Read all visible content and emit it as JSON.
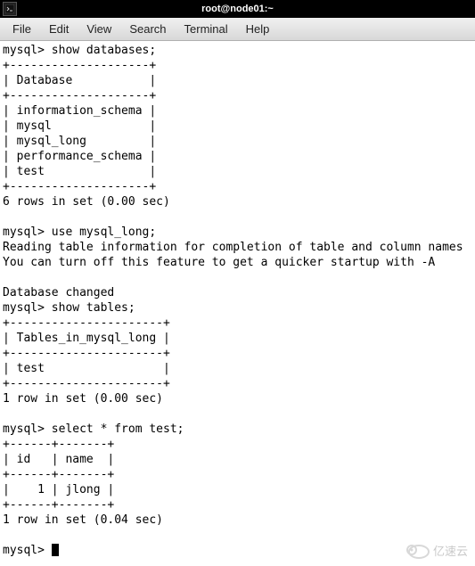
{
  "window": {
    "title": "root@node01:~"
  },
  "menu": {
    "items": [
      "File",
      "Edit",
      "View",
      "Search",
      "Terminal",
      "Help"
    ]
  },
  "terminal": {
    "prompt": "mysql>",
    "cmd_show_databases": "mysql> show databases;",
    "db_divider": "+--------------------+",
    "db_header": "| Database           |",
    "db_rows": [
      "| information_schema |",
      "| mysql              |",
      "| mysql_long         |",
      "| performance_schema |",
      "| test               |"
    ],
    "db_result": "6 rows in set (0.00 sec)",
    "cmd_use": "mysql> use mysql_long;",
    "use_msg1": "Reading table information for completion of table and column names",
    "use_msg2": "You can turn off this feature to get a quicker startup with -A",
    "use_msg3": "Database changed",
    "cmd_show_tables": "mysql> show tables;",
    "tbl_divider": "+----------------------+",
    "tbl_header": "| Tables_in_mysql_long |",
    "tbl_rows": [
      "| test                 |"
    ],
    "tbl_result": "1 row in set (0.00 sec)",
    "cmd_select": "mysql> select * from test;",
    "sel_divider": "+------+-------+",
    "sel_header": "| id   | name  |",
    "sel_rows": [
      "|    1 | jlong |"
    ],
    "sel_result": "1 row in set (0.04 sec)",
    "prompt_final": "mysql> "
  },
  "watermark": {
    "text": "亿速云"
  }
}
